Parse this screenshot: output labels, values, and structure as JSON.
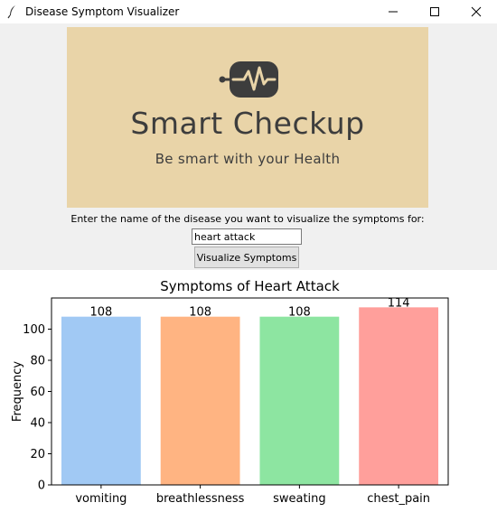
{
  "window": {
    "title": "Disease Symptom Visualizer",
    "icon": "feather-icon",
    "controls": [
      "minimize-icon",
      "maximize-icon",
      "close-icon"
    ]
  },
  "banner": {
    "title": "Smart Checkup",
    "subtitle": "Be smart with your Health",
    "icon": "heartbeat-monitor-icon",
    "background": "#e9d4a8",
    "text_color": "#3d3d3d"
  },
  "form": {
    "prompt": "Enter the name of the disease you want to visualize the symptoms for:",
    "input_value": "heart attack",
    "button_label": "Visualize Symptoms"
  },
  "chart_data": {
    "type": "bar",
    "title": "Symptoms of Heart Attack",
    "xlabel": "",
    "ylabel": "Frequency",
    "categories": [
      "vomiting",
      "breathlessness",
      "sweating",
      "chest_pain"
    ],
    "values": [
      108,
      108,
      108,
      114
    ],
    "data_labels": [
      "108",
      "108",
      "108",
      "114"
    ],
    "colors": [
      "#a1c9f4",
      "#ffb482",
      "#8de5a1",
      "#ff9f9b"
    ],
    "ylim": [
      0,
      120
    ],
    "yticks": [
      0,
      20,
      40,
      60,
      80,
      100
    ],
    "grid": false
  }
}
